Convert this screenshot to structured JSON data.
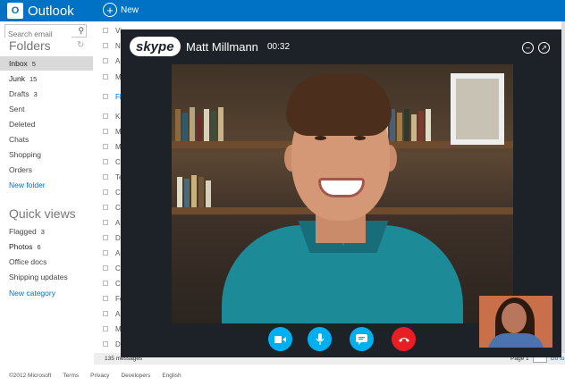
{
  "app": {
    "brand": "Outlook",
    "new_label": "New"
  },
  "search": {
    "placeholder": "Search email"
  },
  "folders": {
    "title": "Folders",
    "items": [
      {
        "label": "Inbox",
        "count": "5"
      },
      {
        "label": "Junk",
        "count": "15"
      },
      {
        "label": "Drafts",
        "count": "3"
      },
      {
        "label": "Sent",
        "count": ""
      },
      {
        "label": "Deleted",
        "count": ""
      },
      {
        "label": "Chats",
        "count": ""
      },
      {
        "label": "Shopping",
        "count": ""
      },
      {
        "label": "Orders",
        "count": ""
      }
    ],
    "new_folder": "New folder"
  },
  "quick_views": {
    "title": "Quick views",
    "items": [
      {
        "label": "Flagged",
        "count": "3"
      },
      {
        "label": "Photos",
        "count": "6"
      },
      {
        "label": "Office docs",
        "count": ""
      },
      {
        "label": "Shipping updates",
        "count": ""
      }
    ],
    "new_category": "New category"
  },
  "messages": {
    "initials": [
      "Vi",
      "N",
      "Ar",
      "M",
      "Fl",
      "Ka",
      "M",
      "M",
      "Cl",
      "Te",
      "Cl",
      "Cl",
      "Ar",
      "Dy",
      "Ar",
      "Cl",
      "Co",
      "Fo",
      "Ar",
      "M",
      "Dy"
    ],
    "count_text": "135 messages",
    "page_text": "Page 1",
    "go_text": "Go to"
  },
  "skype": {
    "logo": "skype",
    "caller": "Matt Millmann",
    "duration": "00:32",
    "minimize_icon": "–",
    "popout_icon": "↗"
  },
  "footer": {
    "links": [
      "©2012 Microsoft",
      "Terms",
      "Privacy",
      "Developers",
      "English"
    ]
  },
  "colors": {
    "outlook_blue": "#0072c6",
    "skype_blue": "#00aff0",
    "hangup_red": "#e81e24"
  }
}
